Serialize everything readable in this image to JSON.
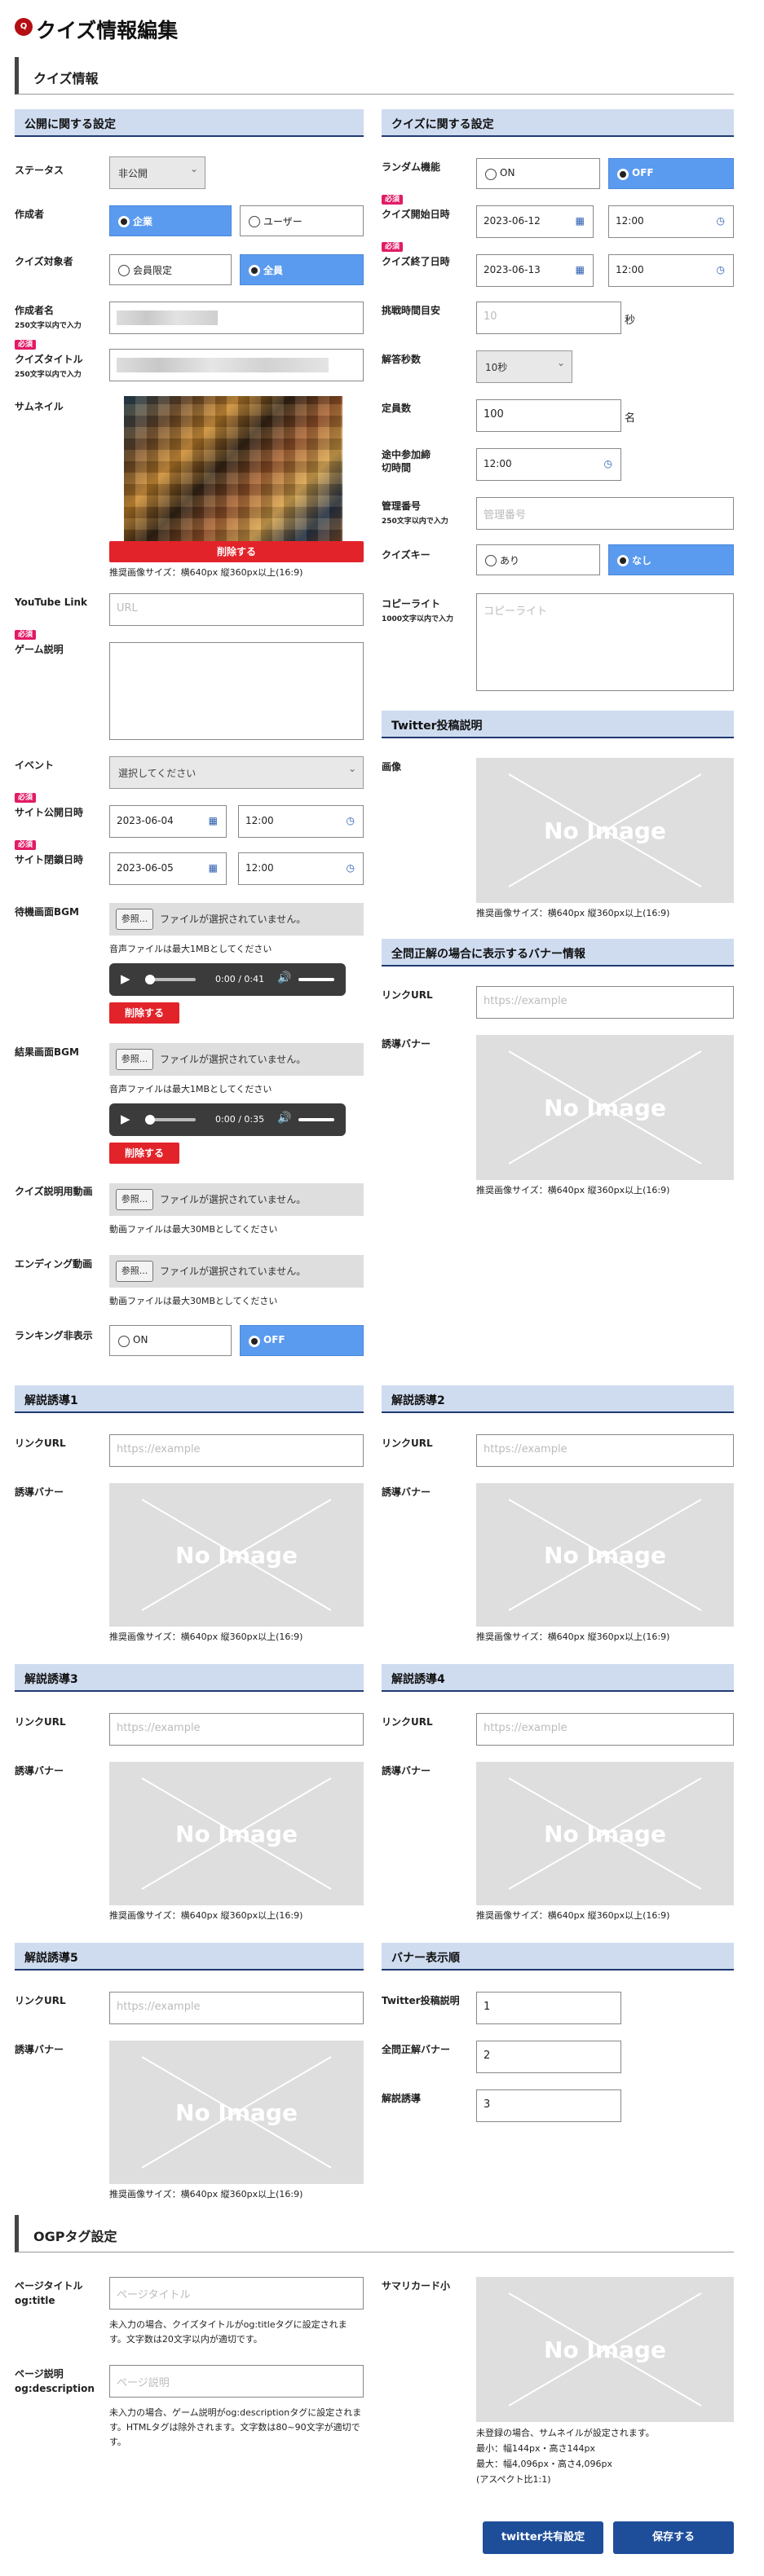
{
  "header": {
    "title": "クイズ情報編集",
    "card": "クイズ情報",
    "icon": "quiz-icon"
  },
  "left": {
    "section": "公開に関する設定",
    "status": {
      "label": "ステータス",
      "value": "非公開"
    },
    "creator": {
      "label": "作成者",
      "opt1": "企業",
      "opt2": "ユーザー"
    },
    "target": {
      "label": "クイズ対象者",
      "opt1": "会員限定",
      "opt2": "全員"
    },
    "creator_name": {
      "label": "作成者名",
      "sub": "250文字以内で入力"
    },
    "quiz_title": {
      "label": "クイズタイトル",
      "sub": "250文字以内で入力",
      "req": "必須"
    },
    "thumbnail": {
      "label": "サムネイル",
      "delete": "削除する",
      "note": "推奨画像サイズ：横640px 縦360px以上(16:9)"
    },
    "youtube": {
      "label": "YouTube Link",
      "placeholder": "URL"
    },
    "game_desc": {
      "label": "ゲーム説明",
      "req": "必須"
    },
    "event": {
      "label": "イベント",
      "value": "選択してください"
    },
    "open_date": {
      "label": "サイト公開日時",
      "req": "必須",
      "date": "2023-06-04",
      "time": "12:00"
    },
    "close_date": {
      "label": "サイト閉鎖日時",
      "req": "必須",
      "date": "2023-06-05",
      "time": "12:00"
    },
    "wait_bgm": {
      "label": "待機画面BGM",
      "btn": "参照...",
      "file": "ファイルが選択されていません。",
      "note": "音声ファイルは最大1MBとしてください",
      "time": "0:00 / 0:41",
      "delete": "削除する"
    },
    "result_bgm": {
      "label": "結果画面BGM",
      "btn": "参照...",
      "file": "ファイルが選択されていません。",
      "note": "音声ファイルは最大1MBとしてください",
      "time": "0:00 / 0:35",
      "delete": "削除する"
    },
    "desc_video": {
      "label": "クイズ説明用動画",
      "btn": "参照...",
      "file": "ファイルが選択されていません。",
      "note": "動画ファイルは最大30MBとしてください"
    },
    "ending_video": {
      "label": "エンディング動画",
      "btn": "参照...",
      "file": "ファイルが選択されていません。",
      "note": "動画ファイルは最大30MBとしてください"
    },
    "ranking": {
      "label": "ランキング非表示",
      "opt1": "ON",
      "opt2": "OFF"
    }
  },
  "right": {
    "section": "クイズに関する設定",
    "random": {
      "label": "ランダム機能",
      "opt1": "ON",
      "opt2": "OFF"
    },
    "start": {
      "label": "クイズ開始日時",
      "req": "必須",
      "date": "2023-06-12",
      "time": "12:00"
    },
    "end": {
      "label": "クイズ終了日時",
      "req": "必須",
      "date": "2023-06-13",
      "time": "12:00"
    },
    "challenge": {
      "label": "挑戦時間目安",
      "placeholder": "10",
      "unit": "秒"
    },
    "answer_sec": {
      "label": "解答秒数",
      "value": "10秒"
    },
    "capacity": {
      "label": "定員数",
      "value": "100",
      "unit": "名"
    },
    "join_deadline": {
      "label": "途中参加締切時間",
      "value": "12:00"
    },
    "manage_no": {
      "label": "管理番号",
      "sub": "250文字以内で入力",
      "placeholder": "管理番号"
    },
    "quiz_key": {
      "label": "クイズキー",
      "opt1": "あり",
      "opt2": "なし"
    },
    "copyright": {
      "label": "コピーライト",
      "sub": "1000文字以内で入力",
      "placeholder": "コピーライト"
    },
    "twitter_section": "Twitter投稿説明",
    "twitter_image": {
      "label": "画像",
      "noimg": "No Image",
      "note": "推奨画像サイズ：横640px 縦360px以上(16:9)"
    },
    "banner_section": "全問正解の場合に表示するバナー情報",
    "banner_link": {
      "label": "リンクURL",
      "placeholder": "https://example"
    },
    "banner": {
      "label": "誘導バナー",
      "noimg": "No Image",
      "note": "推奨画像サイズ：横640px 縦360px以上(16:9)"
    }
  },
  "guides": [
    {
      "title": "解説誘導1",
      "link_label": "リンクURL",
      "placeholder": "https://example",
      "banner_label": "誘導バナー",
      "noimg": "No Image",
      "note": "推奨画像サイズ：横640px 縦360px以上(16:9)"
    },
    {
      "title": "解説誘導2",
      "link_label": "リンクURL",
      "placeholder": "https://example",
      "banner_label": "誘導バナー",
      "noimg": "No Image",
      "note": "推奨画像サイズ：横640px 縦360px以上(16:9)"
    },
    {
      "title": "解説誘導3",
      "link_label": "リンクURL",
      "placeholder": "https://example",
      "banner_label": "誘導バナー",
      "noimg": "No Image",
      "note": "推奨画像サイズ：横640px 縦360px以上(16:9)"
    },
    {
      "title": "解説誘導4",
      "link_label": "リンクURL",
      "placeholder": "https://example",
      "banner_label": "誘導バナー",
      "noimg": "No Image",
      "note": "推奨画像サイズ：横640px 縦360px以上(16:9)"
    },
    {
      "title": "解説誘導5",
      "link_label": "リンクURL",
      "placeholder": "https://example",
      "banner_label": "誘導バナー",
      "noimg": "No Image",
      "note": "推奨画像サイズ：横640px 縦360px以上(16:9)"
    }
  ],
  "banner_order": {
    "title": "バナー表示順",
    "twitter_label": "Twitter投稿説明",
    "twitter_value": "1",
    "all_correct_label": "全問正解バナー",
    "all_correct_value": "2",
    "guide_label": "解説誘導",
    "guide_value": "3"
  },
  "ogp": {
    "title": "OGPタグ設定",
    "page_title_label": "ページタイトル",
    "page_title_sub": "og:title",
    "page_title_placeholder": "ページタイトル",
    "page_title_note": "未入力の場合、クイズタイトルがog:titleタグに設定されます。文字数は20文字以内が適切です。",
    "page_desc_label": "ページ説明",
    "page_desc_sub": "og:description",
    "page_desc_placeholder": "ページ説明",
    "page_desc_note": "未入力の場合、ゲーム説明がog:descriptionタグに設定されます。HTMLタグは除外されます。文字数は80~90文字が適切です。",
    "summary_label": "サマリカード小",
    "noimg": "No Image",
    "summary_note1": "未登録の場合、サムネイルが設定されます。",
    "summary_note2": "最小：幅144px・高さ144px",
    "summary_note3": "最大：幅4,096px・高さ4,096px",
    "summary_note4": "(アスペクト比1:1)"
  },
  "actions": {
    "twitter_share": "twitter共有設定",
    "save": "保存する"
  }
}
